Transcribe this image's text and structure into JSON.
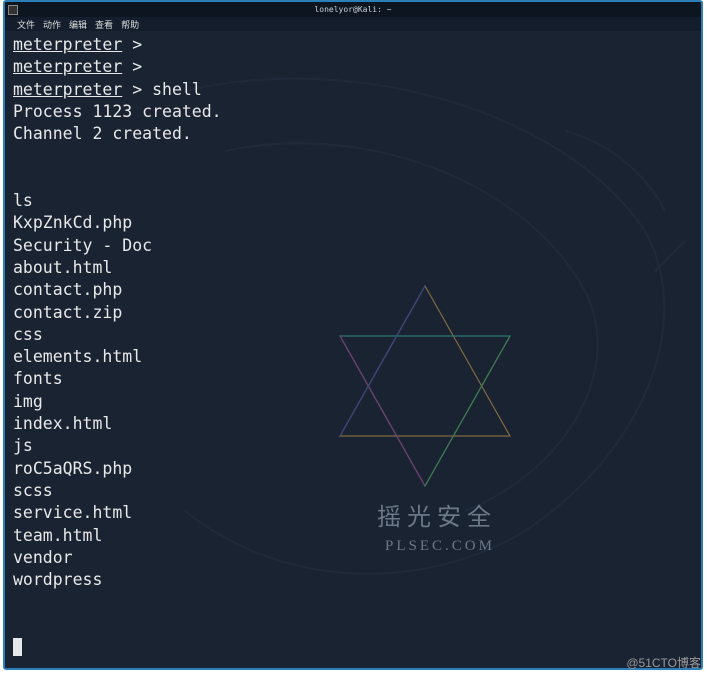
{
  "titlebar": {
    "title": "lonelyor@Kali: ~"
  },
  "menubar": {
    "items": [
      "文件",
      "动作",
      "编辑",
      "查看",
      "帮助"
    ]
  },
  "terminal": {
    "prompt_text": "meterpreter",
    "prompt_symbol": ">",
    "lines": [
      {
        "type": "prompt",
        "cmd": ""
      },
      {
        "type": "prompt",
        "cmd": ""
      },
      {
        "type": "prompt",
        "cmd": "shell"
      },
      {
        "type": "out",
        "text": "Process 1123 created."
      },
      {
        "type": "out",
        "text": "Channel 2 created."
      },
      {
        "type": "blank"
      },
      {
        "type": "blank"
      },
      {
        "type": "out",
        "text": "ls"
      },
      {
        "type": "out",
        "text": "KxpZnkCd.php"
      },
      {
        "type": "out",
        "text": "Security - Doc"
      },
      {
        "type": "out",
        "text": "about.html"
      },
      {
        "type": "out",
        "text": "contact.php"
      },
      {
        "type": "out",
        "text": "contact.zip"
      },
      {
        "type": "out",
        "text": "css"
      },
      {
        "type": "out",
        "text": "elements.html"
      },
      {
        "type": "out",
        "text": "fonts"
      },
      {
        "type": "out",
        "text": "img"
      },
      {
        "type": "out",
        "text": "index.html"
      },
      {
        "type": "out",
        "text": "js"
      },
      {
        "type": "out",
        "text": "roC5aQRS.php"
      },
      {
        "type": "out",
        "text": "scss"
      },
      {
        "type": "out",
        "text": "service.html"
      },
      {
        "type": "out",
        "text": "team.html"
      },
      {
        "type": "out",
        "text": "vendor"
      },
      {
        "type": "out",
        "text": "wordpress"
      },
      {
        "type": "blank"
      },
      {
        "type": "blank"
      },
      {
        "type": "cursor"
      }
    ]
  },
  "watermark": {
    "cn": "摇光安全",
    "en": "PLSEC.COM",
    "cto": "@51CTO博客"
  }
}
